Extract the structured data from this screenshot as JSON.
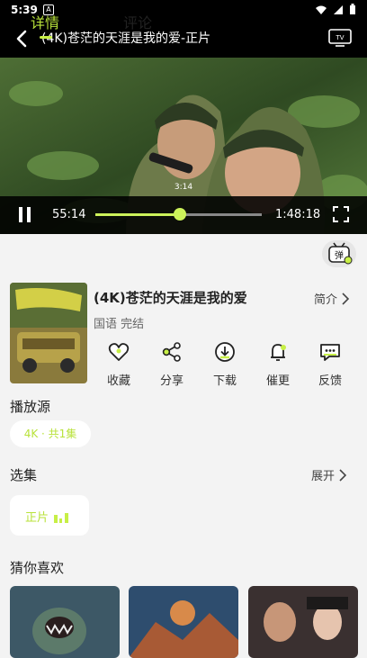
{
  "status": {
    "time": "5:39",
    "a_badge": "A"
  },
  "header": {
    "title": "(4K)苍茫的天涯是我的爱-正片",
    "tv_label": "TV"
  },
  "player": {
    "subtitle": "3:14",
    "current_time": "55:14",
    "total_time": "1:48:18",
    "progress": 0.51
  },
  "tabs": [
    {
      "label": "详情"
    },
    {
      "label": "评论"
    }
  ],
  "danmaku_label": "弹",
  "movie": {
    "name": "(4K)苍茫的天涯是我的爱",
    "meta": "国语 完结",
    "intro_label": "简介"
  },
  "actions": [
    {
      "label": "收藏",
      "icon": "heart-icon"
    },
    {
      "label": "分享",
      "icon": "share-icon"
    },
    {
      "label": "下载",
      "icon": "download-icon"
    },
    {
      "label": "催更",
      "icon": "bell-icon"
    },
    {
      "label": "反馈",
      "icon": "feedback-icon"
    }
  ],
  "source": {
    "title": "播放源",
    "chip": "4K · 共1集"
  },
  "episodes": {
    "title": "选集",
    "expand": "展开",
    "chip": "正片"
  },
  "recommend": {
    "title": "猜你喜欢"
  },
  "colors": {
    "accent": "#c7ef46",
    "accent_text": "#b8e23a",
    "bg": "#f3f3f3"
  }
}
